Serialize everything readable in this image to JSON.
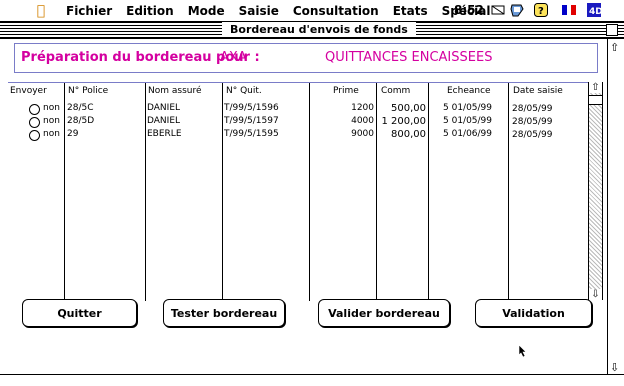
{
  "menubar": {
    "items": [
      "Fichier",
      "Edition",
      "Mode",
      "Saisie",
      "Consultation",
      "Etats",
      "Spécial"
    ],
    "clock": "8:52"
  },
  "window": {
    "title": "Bordereau d'envois de fonds"
  },
  "header": {
    "label": "Préparation du bordereau pour :",
    "company": "AXA",
    "type": "QUITTANCES ENCAISSEES"
  },
  "table": {
    "columns": [
      "Envoyer",
      "N° Police",
      "Nom assuré",
      "N° Quit.",
      "Prime",
      "Comm",
      "Echeance",
      "Date saisie"
    ],
    "rows": [
      {
        "envoyer": "non",
        "police": "28/5C",
        "nom": "DANIEL",
        "quit": "T/99/5/1596",
        "prime": "1200",
        "comm": "500,00",
        "echeance": "5 01/05/99",
        "date": "28/05/99"
      },
      {
        "envoyer": "non",
        "police": "28/5D",
        "nom": "DANIEL",
        "quit": "T/99/5/1597",
        "prime": "4000",
        "comm": "1 200,00",
        "echeance": "5 01/05/99",
        "date": "28/05/99"
      },
      {
        "envoyer": "non",
        "police": "29",
        "nom": "EBERLE",
        "quit": "T/99/5/1595",
        "prime": "9000",
        "comm": "800,00",
        "echeance": "5 01/06/99",
        "date": "28/05/99"
      }
    ]
  },
  "buttons": {
    "quitter": "Quitter",
    "tester": "Tester bordereau",
    "valider": "Valider bordereau",
    "validation": "Validation"
  },
  "icons": [
    "apple-icon",
    "network-icon",
    "help-icon",
    "flag-icon",
    "app-icon",
    "zoom-box-icon",
    "scroll-up-icon",
    "scroll-down-icon"
  ]
}
